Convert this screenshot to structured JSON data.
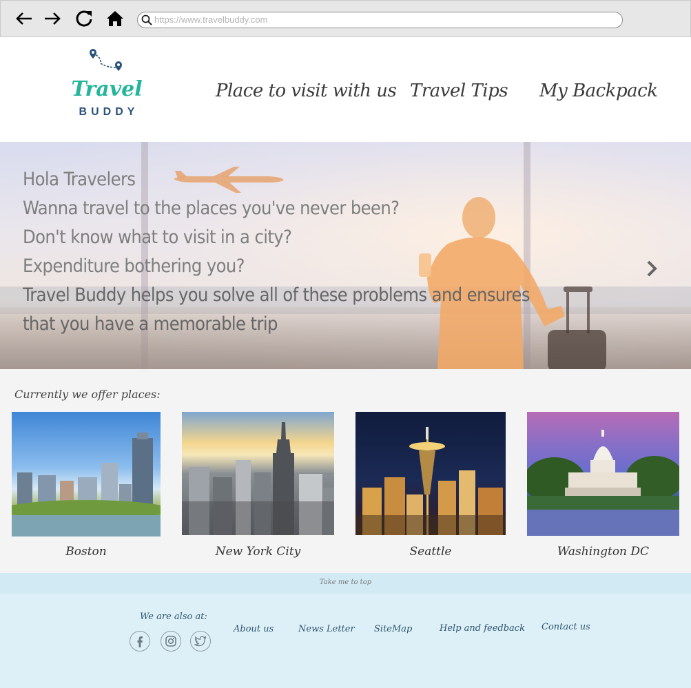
{
  "browser": {
    "url": "https://www.travelbuddy.com",
    "icons": [
      "back-arrow-icon",
      "forward-arrow-icon",
      "reload-icon",
      "home-icon",
      "search-icon"
    ]
  },
  "header": {
    "logo_word_1": "Travel",
    "logo_word_2": "BUDDY",
    "nav": [
      {
        "label": "Place to visit with us"
      },
      {
        "label": "Travel Tips"
      },
      {
        "label": "My Backpack"
      }
    ]
  },
  "hero": {
    "lines": [
      "Hola Travelers",
      "Wanna travel to the places you've never been?",
      "Don't know what to visit in a city?",
      "Expenditure bothering you?",
      "Travel Buddy helps you solve all of these problems and ensures",
      "that you have a memorable trip"
    ],
    "next_icon": "chevron-right-icon"
  },
  "places": {
    "heading": "Currently we offer places:",
    "cities": [
      {
        "name": "Boston"
      },
      {
        "name": "New York City"
      },
      {
        "name": "Seattle"
      },
      {
        "name": "Washington DC"
      }
    ]
  },
  "footer": {
    "top_link": "Take me to top",
    "also_at": "We are also at:",
    "social_icons": [
      "facebook-icon",
      "instagram-icon",
      "twitter-icon"
    ],
    "links": [
      {
        "label": "About us"
      },
      {
        "label": "News Letter"
      },
      {
        "label": "SiteMap"
      },
      {
        "label": "Help and feedback"
      },
      {
        "label": "Contact us"
      }
    ]
  },
  "colors": {
    "logo_green": "#25b59a",
    "logo_navy": "#2a5178",
    "footer_bg": "#def0f7",
    "footer_text": "#2d5570"
  }
}
